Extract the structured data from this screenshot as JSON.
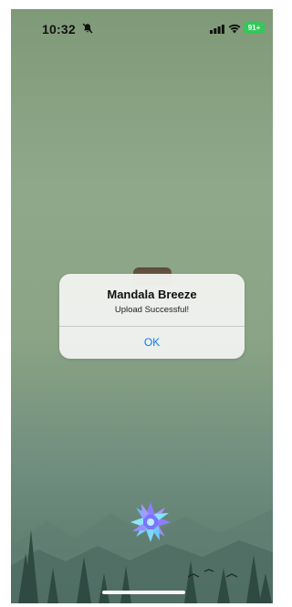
{
  "status_bar": {
    "time": "10:32",
    "battery": "91+",
    "icons": [
      "bell-icon",
      "signal-icon",
      "wifi-icon",
      "battery-icon"
    ]
  },
  "dialog": {
    "title": "Mandala Breeze",
    "message": "Upload Successful!",
    "ok_label": "OK"
  },
  "colors": {
    "background_top": "#7f9a78",
    "background_bottom": "#567669",
    "dialog_bg": "#f0f1ef",
    "ok_color": "#0a7aff",
    "battery_green": "#34c759"
  },
  "icons": {
    "mandala": "mandala-icon",
    "home": "home-indicator"
  }
}
